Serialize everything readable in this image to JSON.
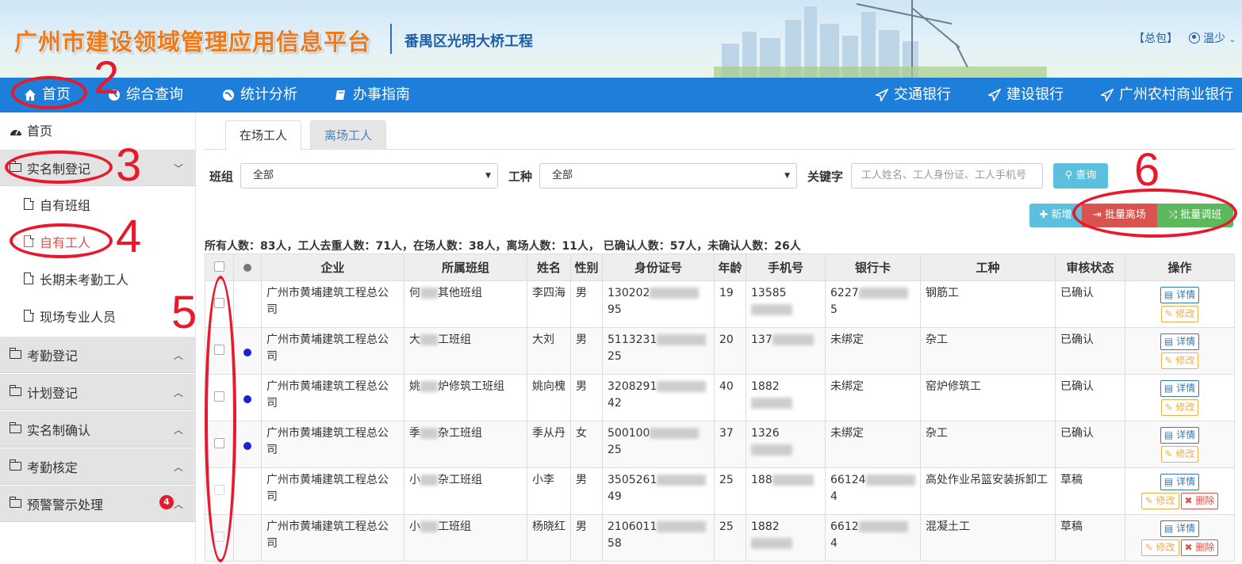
{
  "header": {
    "title": "广州市建设领域管理应用信息平台",
    "project": "番禺区光明大桥工程",
    "package_label": "【总包】",
    "user_name": "温少"
  },
  "nav": {
    "left": [
      "首页",
      "综合查询",
      "统计分析",
      "办事指南"
    ],
    "right": [
      "交通银行",
      "建设银行",
      "广州农村商业银行"
    ]
  },
  "sidebar": {
    "home": "首页",
    "groups": [
      {
        "label": "实名制登记",
        "expanded": true,
        "children": [
          "自有班组",
          "自有工人",
          "长期未考勤工人",
          "现场专业人员"
        ]
      },
      {
        "label": "考勤登记"
      },
      {
        "label": "计划登记"
      },
      {
        "label": "实名制确认"
      },
      {
        "label": "考勤核定"
      },
      {
        "label": "预警警示处理",
        "badge": "4"
      }
    ]
  },
  "tabs": [
    "在场工人",
    "离场工人"
  ],
  "filters": {
    "group_label": "班组",
    "group_value": "全部",
    "trade_label": "工种",
    "trade_value": "全部",
    "keyword_label": "关键字",
    "keyword_placeholder": "工人姓名、工人身份证、工人手机号",
    "search_btn": "查询"
  },
  "actions": {
    "add": "新增",
    "batch_leave": "批量离场",
    "batch_transfer": "批量调班"
  },
  "stats_text": "所有人数：83人，工人去重人数：71人，在场人数：38人，离场人数：11人， 已确认人数：57人，未确认人数：26人",
  "table": {
    "headers": [
      "企业",
      "所属班组",
      "姓名",
      "性别",
      "身份证号",
      "年龄",
      "手机号",
      "银行卡",
      "工种",
      "审核状态",
      "操作"
    ],
    "rows": [
      {
        "company": "广州市黄埔建筑工程总公司",
        "team_a": "何",
        "team_b": "其他班组",
        "name": "李四海",
        "gender": "男",
        "id_a": "130202",
        "id_b": "95",
        "age": "19",
        "phone": "13585",
        "card_a": "6227",
        "card_b": "5",
        "trade": "钢筋工",
        "status": "已确认",
        "dot": false,
        "deletable": false
      },
      {
        "company": "广州市黄埔建筑工程总公司",
        "team_a": "大",
        "team_b": "工班组",
        "name": "大刘",
        "gender": "男",
        "id_a": "5113231",
        "id_b": "25",
        "age": "20",
        "phone": "137",
        "card_a": "未绑定",
        "card_b": "",
        "trade": "杂工",
        "status": "已确认",
        "dot": true,
        "deletable": false
      },
      {
        "company": "广州市黄埔建筑工程总公司",
        "team_a": "姚",
        "team_b": "炉修筑工班组",
        "name": "姚向槐",
        "gender": "男",
        "id_a": "3208291",
        "id_b": "42",
        "age": "40",
        "phone": "1882",
        "card_a": "未绑定",
        "card_b": "",
        "trade": "窑炉修筑工",
        "status": "已确认",
        "dot": true,
        "deletable": false
      },
      {
        "company": "广州市黄埔建筑工程总公司",
        "team_a": "季",
        "team_b": "杂工班组",
        "name": "季从丹",
        "gender": "女",
        "id_a": "500100",
        "id_b": "25",
        "age": "37",
        "phone": "1326",
        "card_a": "未绑定",
        "card_b": "",
        "trade": "杂工",
        "status": "已确认",
        "dot": true,
        "deletable": false
      },
      {
        "company": "广州市黄埔建筑工程总公司",
        "team_a": "小",
        "team_b": "杂工班组",
        "name": "小李",
        "gender": "男",
        "id_a": "3505261",
        "id_b": "49",
        "age": "25",
        "phone": "188",
        "card_a": "66124",
        "card_b": "4",
        "trade": "高处作业吊篮安装拆卸工",
        "status": "草稿",
        "dot": false,
        "deletable": true
      },
      {
        "company": "广州市黄埔建筑工程总公司",
        "team_a": "小",
        "team_b": "工班组",
        "name": "杨晓红",
        "gender": "男",
        "id_a": "2106011",
        "id_b": "58",
        "age": "25",
        "phone": "1882",
        "card_a": "6612",
        "card_b": "4",
        "trade": "混凝土工",
        "status": "草稿",
        "dot": false,
        "deletable": true
      }
    ],
    "op_detail": "详情",
    "op_edit": "修改",
    "op_delete": "删除"
  },
  "annotations": [
    "2",
    "3",
    "4",
    "5",
    "6"
  ],
  "colors": {
    "nav_bg": "#1d7fd9",
    "annotation": "#e8192c",
    "title_orange": "#f07a1a"
  }
}
